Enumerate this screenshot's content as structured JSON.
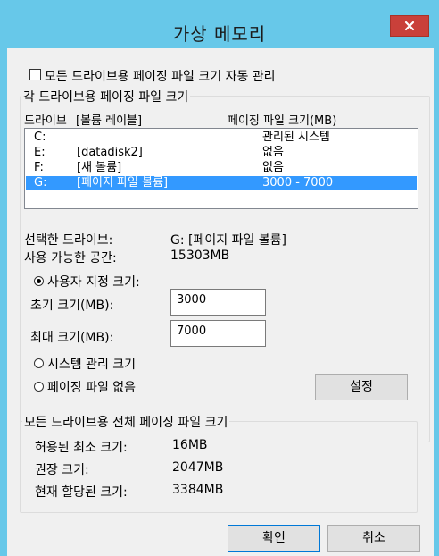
{
  "window": {
    "title": "가상 메모리"
  },
  "auto_manage": {
    "label": "모든 드라이브용 페이징 파일 크기 자동 관리",
    "checked": false
  },
  "drives_group": {
    "title": "각 드라이브용 페이징 파일 크기",
    "col_drive": "드라이브",
    "col_label": "[볼륨 레이블]",
    "col_size": "페이징 파일 크기(MB)",
    "rows": [
      {
        "drive": "C:",
        "label": "",
        "size": "관리된 시스템",
        "selected": false
      },
      {
        "drive": "E:",
        "label": "[datadisk2]",
        "size": "없음",
        "selected": false
      },
      {
        "drive": "F:",
        "label": "[새 볼륨]",
        "size": "없음",
        "selected": false
      },
      {
        "drive": "G:",
        "label": "[페이지 파일 볼륨]",
        "size": "3000 - 7000",
        "selected": true
      }
    ],
    "selected_drive_label": "선택한 드라이브:",
    "selected_drive_value": "G:  [페이지 파일 볼륨]",
    "free_space_label": "사용 가능한 공간:",
    "free_space_value": "15303MB",
    "custom_size_label": "사용자 지정 크기:",
    "initial_size_label": "초기 크기(MB):",
    "initial_size_value": "3000",
    "max_size_label": "최대 크기(MB):",
    "max_size_value": "7000",
    "system_managed_label": "시스템 관리 크기",
    "no_paging_label": "페이징 파일 없음",
    "set_button": "설정",
    "selected_option": "custom"
  },
  "total_group": {
    "title": "모든 드라이브용 전체 페이징 파일 크기",
    "min_label": "허용된 최소 크기:",
    "min_value": "16MB",
    "recommended_label": "권장 크기:",
    "recommended_value": "2047MB",
    "current_label": "현재 할당된 크기:",
    "current_value": "3384MB"
  },
  "buttons": {
    "ok": "확인",
    "cancel": "취소"
  }
}
